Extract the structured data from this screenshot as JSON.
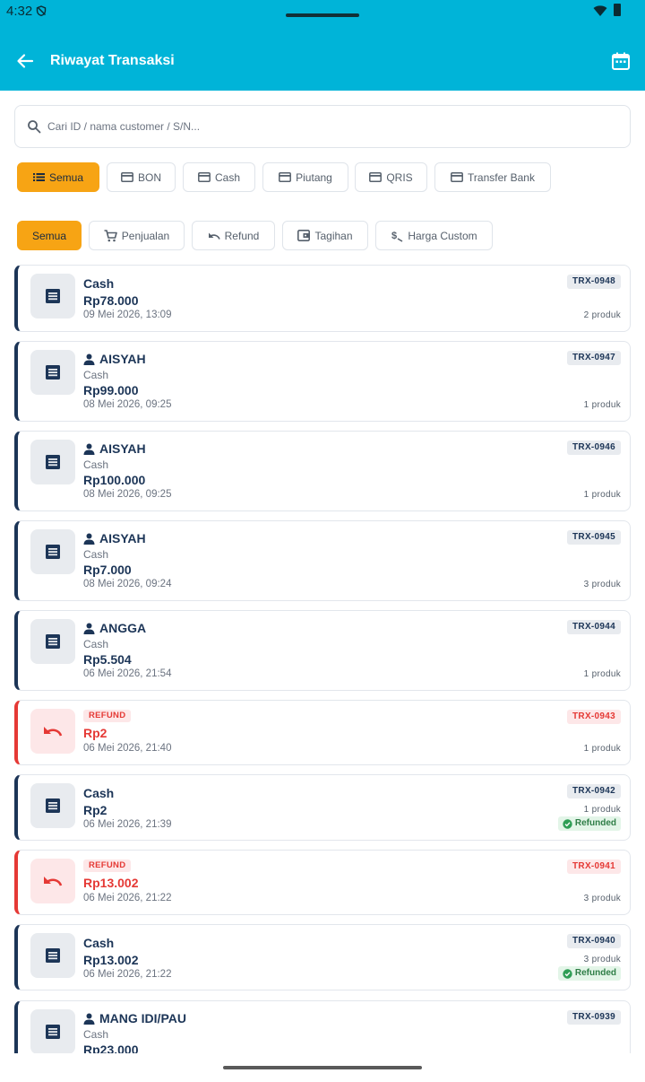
{
  "status_bar": {
    "time": "4:32"
  },
  "header": {
    "title": "Riwayat Transaksi",
    "accent": "#00b4d8"
  },
  "search": {
    "placeholder": "Cari ID / nama customer / S/N..."
  },
  "payment_filters": [
    {
      "label": "Semua",
      "icon": "list-icon",
      "active": true
    },
    {
      "label": "BON",
      "icon": "card-icon",
      "active": false
    },
    {
      "label": "Cash",
      "icon": "card-icon",
      "active": false
    },
    {
      "label": "Piutang",
      "icon": "card-icon",
      "active": false
    },
    {
      "label": "QRIS",
      "icon": "card-icon",
      "active": false
    },
    {
      "label": "Transfer Bank",
      "icon": "card-icon",
      "active": false
    }
  ],
  "type_filters": [
    {
      "label": "Semua",
      "icon": "",
      "active": true
    },
    {
      "label": "Penjualan",
      "icon": "cart-icon",
      "active": false
    },
    {
      "label": "Refund",
      "icon": "undo-icon",
      "active": false
    },
    {
      "label": "Tagihan",
      "icon": "wallet-icon",
      "active": false
    },
    {
      "label": "Harga Custom",
      "icon": "price-tag-icon",
      "active": false
    }
  ],
  "transactions": [
    {
      "id": "TRX-0948",
      "kind": "sale",
      "customer": "",
      "method": "Cash",
      "amount": "Rp78.000",
      "date": "09 Mei 2026, 13:09",
      "items": "2 produk",
      "refunded": ""
    },
    {
      "id": "TRX-0947",
      "kind": "sale",
      "customer": "AISYAH",
      "method": "Cash",
      "amount": "Rp99.000",
      "date": "08 Mei 2026, 09:25",
      "items": "1 produk",
      "refunded": ""
    },
    {
      "id": "TRX-0946",
      "kind": "sale",
      "customer": "AISYAH",
      "method": "Cash",
      "amount": "Rp100.000",
      "date": "08 Mei 2026, 09:25",
      "items": "1 produk",
      "refunded": ""
    },
    {
      "id": "TRX-0945",
      "kind": "sale",
      "customer": "AISYAH",
      "method": "Cash",
      "amount": "Rp7.000",
      "date": "08 Mei 2026, 09:24",
      "items": "3 produk",
      "refunded": ""
    },
    {
      "id": "TRX-0944",
      "kind": "sale",
      "customer": "ANGGA",
      "method": "Cash",
      "amount": "Rp5.504",
      "date": "06 Mei 2026, 21:54",
      "items": "1 produk",
      "refunded": ""
    },
    {
      "id": "TRX-0943",
      "kind": "refund",
      "badge": "REFUND",
      "amount": "Rp2",
      "date": "06 Mei 2026, 21:40",
      "items": "1 produk"
    },
    {
      "id": "TRX-0942",
      "kind": "sale",
      "customer": "",
      "method": "Cash",
      "amount": "Rp2",
      "date": "06 Mei 2026, 21:39",
      "items": "1 produk",
      "refunded": "Refunded"
    },
    {
      "id": "TRX-0941",
      "kind": "refund",
      "badge": "REFUND",
      "amount": "Rp13.002",
      "date": "06 Mei 2026, 21:22",
      "items": "3 produk"
    },
    {
      "id": "TRX-0940",
      "kind": "sale",
      "customer": "",
      "method": "Cash",
      "amount": "Rp13.002",
      "date": "06 Mei 2026, 21:22",
      "items": "3 produk",
      "refunded": "Refunded"
    },
    {
      "id": "TRX-0939",
      "kind": "sale",
      "customer": "MANG IDI/PAU",
      "method": "Cash",
      "amount": "Rp23.000",
      "date": "",
      "items": "",
      "refunded": ""
    }
  ]
}
